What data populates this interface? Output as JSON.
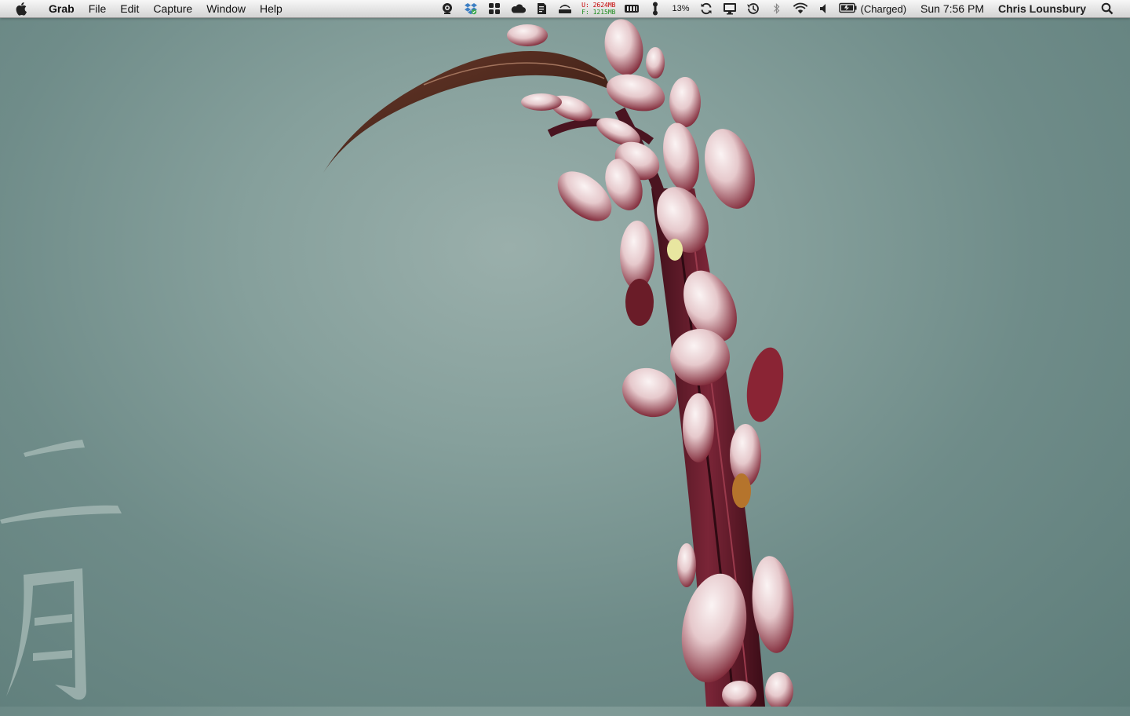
{
  "menubar": {
    "app_name": "Grab",
    "menus": [
      "File",
      "Edit",
      "Capture",
      "Window",
      "Help"
    ],
    "status": {
      "memory_used": "U: 2624MB",
      "memory_free": "F: 1215MB",
      "cpu_percent": "13%",
      "battery_status": "(Charged)",
      "clock": "Sun 7:56 PM",
      "user_name": "Chris Lounsbury"
    },
    "icons": [
      "apple-icon",
      "monitor-eye-icon",
      "dropbox-icon",
      "spaces-icon",
      "cloud-icon",
      "notes-icon",
      "router-icon",
      "memory-chip-icon",
      "temperature-icon",
      "sync-icon",
      "display-icon",
      "time-machine-icon",
      "bluetooth-icon",
      "wifi-icon",
      "volume-icon",
      "battery-icon",
      "spotlight-icon"
    ]
  },
  "colors": {
    "wallpaper_bg": "#86a09c",
    "memory_used": "#c40000",
    "memory_free": "#1a8a1a"
  }
}
